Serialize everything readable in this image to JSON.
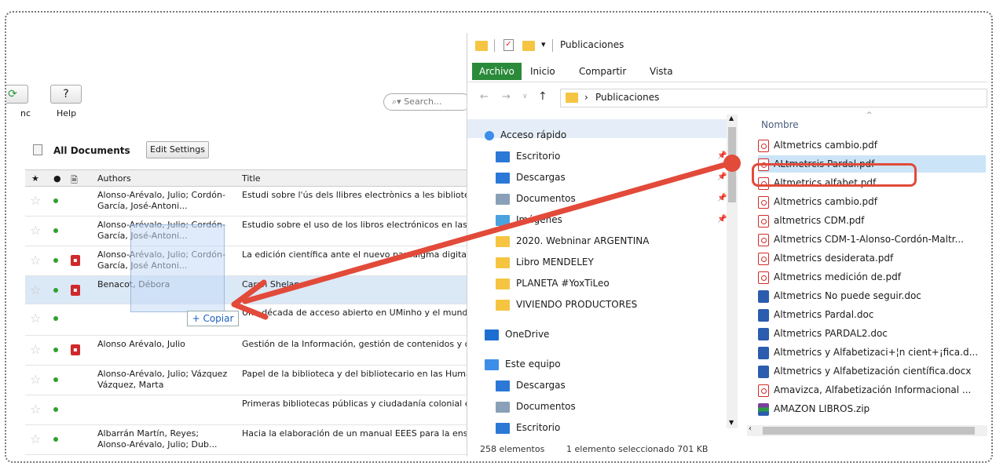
{
  "mendeley": {
    "toolbar": {
      "sync_label": "nc",
      "help_label": "Help",
      "search_placeholder": "Search..."
    },
    "doc_header": {
      "title": "All Documents",
      "edit_settings": "Edit Settings"
    },
    "columns": {
      "authors": "Authors",
      "title": "Title"
    },
    "rows": [
      {
        "authors": "Alonso-Arévalo, Julio; Cordón-García, José-Antoni...",
        "title": "Estudi sobre l'ús dels llibres electrònics a les bibliotequ universitàries de Castella i Lleó",
        "pdf": false
      },
      {
        "authors": "Alonso-Arévalo, Julio; Cordón-García, José-Antoni...",
        "title": "Estudio sobre el uso de los libros electrónicos en las bibliotecas universitarias de Castilla y León",
        "pdf": false
      },
      {
        "authors": "Alonso-Arévalo, Julio; Cordón-García, José Antoni...",
        "title": "La edición científica ante el nuevo paradigma digital.",
        "pdf": true
      },
      {
        "authors": "Benacot, Débora",
        "title": "Caron Shelan",
        "pdf": true
      },
      {
        "authors": "",
        "title": "Una década de acceso abierto en UMinho y el mundo Universo Abierto",
        "pdf": false
      },
      {
        "authors": "Alonso Arévalo, Julio",
        "title": "Gestión de la Información, gestión de contenidos y conocimiento.",
        "pdf": true
      },
      {
        "authors": "Alonso-Arévalo, Julio; Vázquez Vázquez, Marta",
        "title": "Papel de la biblioteca y del bibliotecario en las Human Digitales",
        "pdf": false
      },
      {
        "authors": "",
        "title": "Primeras bibliotecas públicas y ciudadanía colonial en hemisferio sur británico | Universo Abierto",
        "pdf": false
      },
      {
        "authors": "Albarrán Martín, Reyes; Alonso-Arévalo, Julio; Dub...",
        "title": "Hacia la elaboración de un manual EEES para la ense de las segundas lenguas extranjeras en Traducción e",
        "pdf": false
      }
    ],
    "copy_label": "+ Copiar"
  },
  "explorer": {
    "title": "Publicaciones",
    "tabs": [
      "Archivo",
      "Inicio",
      "Compartir",
      "Vista"
    ],
    "address": "Publicaciones",
    "nav": [
      {
        "label": "Acceso rápido",
        "icon": "star-icon",
        "color": "#3c8ee8",
        "pinned": false
      },
      {
        "label": "Escritorio",
        "icon": "desktop-icon",
        "color": "#2b78d6",
        "pinned": true
      },
      {
        "label": "Descargas",
        "icon": "download-icon",
        "color": "#2b78d6",
        "pinned": true
      },
      {
        "label": "Documentos",
        "icon": "document-icon",
        "color": "#8aa0b8",
        "pinned": true
      },
      {
        "label": "Imágenes",
        "icon": "pictures-icon",
        "color": "#4aa3df",
        "pinned": true
      },
      {
        "label": "2020. Webninar ARGENTINA",
        "icon": "folder-icon",
        "color": "#f5c542",
        "pinned": false
      },
      {
        "label": "Libro MENDELEY",
        "icon": "folder-icon",
        "color": "#f5c542",
        "pinned": false
      },
      {
        "label": "PLANETA #YoxTiLeo",
        "icon": "folder-icon",
        "color": "#f5c542",
        "pinned": false
      },
      {
        "label": "VIVIENDO PRODUCTORES",
        "icon": "folder-icon",
        "color": "#f5c542",
        "pinned": false
      },
      {
        "label": "OneDrive",
        "icon": "cloud-icon",
        "color": "#1c6fd1",
        "pinned": false
      },
      {
        "label": "Este equipo",
        "icon": "computer-icon",
        "color": "#3c8ee8",
        "pinned": false
      },
      {
        "label": "Descargas",
        "icon": "download-icon",
        "color": "#2b78d6",
        "pinned": false
      },
      {
        "label": "Documentos",
        "icon": "document-icon",
        "color": "#8aa0b8",
        "pinned": false
      },
      {
        "label": "Escritorio",
        "icon": "desktop-icon",
        "color": "#2b78d6",
        "pinned": false
      }
    ],
    "column_header": "Nombre",
    "files": [
      {
        "name": "Altmetrics cambio.pdf",
        "type": "pdf"
      },
      {
        "name": "ALtmetrcis  Pardal.pdf",
        "type": "pdf"
      },
      {
        "name": "Altmetrics alfabet.pdf",
        "type": "pdf"
      },
      {
        "name": "Altmetrics cambio.pdf",
        "type": "pdf"
      },
      {
        "name": "altmetrics CDM.pdf",
        "type": "pdf"
      },
      {
        "name": "Altmetrics CDM-1-Alonso-Cordón-Maltr...",
        "type": "pdf"
      },
      {
        "name": "Altmetrics desiderata.pdf",
        "type": "pdf"
      },
      {
        "name": "Altmetrics medición de.pdf",
        "type": "pdf"
      },
      {
        "name": "Altmetrics No puede seguir.doc",
        "type": "doc"
      },
      {
        "name": "Altmetrics Pardal.doc",
        "type": "doc"
      },
      {
        "name": "Altmetrics PARDAL2.doc",
        "type": "doc"
      },
      {
        "name": "Altmetrics y Alfabetizaci+¦n cient+¡fica.d...",
        "type": "doc"
      },
      {
        "name": "Altmetrics y Alfabetización científica.docx",
        "type": "doc"
      },
      {
        "name": "Amavizca, Alfabetización Informacional ...",
        "type": "pdf"
      },
      {
        "name": "AMAZON LIBROS.zip",
        "type": "zip"
      }
    ],
    "status": {
      "count": "258 elementos",
      "selection": "1 elemento seleccionado  701 KB"
    }
  }
}
